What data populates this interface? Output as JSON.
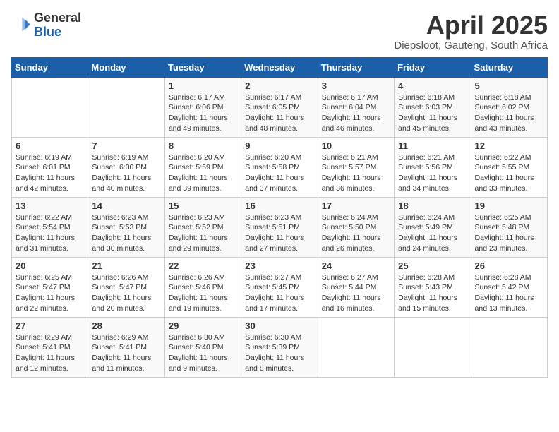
{
  "header": {
    "logo_general": "General",
    "logo_blue": "Blue",
    "title": "April 2025",
    "location": "Diepsloot, Gauteng, South Africa"
  },
  "weekdays": [
    "Sunday",
    "Monday",
    "Tuesday",
    "Wednesday",
    "Thursday",
    "Friday",
    "Saturday"
  ],
  "weeks": [
    [
      null,
      null,
      {
        "day": 1,
        "sunrise": "6:17 AM",
        "sunset": "6:06 PM",
        "daylight": "11 hours and 49 minutes."
      },
      {
        "day": 2,
        "sunrise": "6:17 AM",
        "sunset": "6:05 PM",
        "daylight": "11 hours and 48 minutes."
      },
      {
        "day": 3,
        "sunrise": "6:17 AM",
        "sunset": "6:04 PM",
        "daylight": "11 hours and 46 minutes."
      },
      {
        "day": 4,
        "sunrise": "6:18 AM",
        "sunset": "6:03 PM",
        "daylight": "11 hours and 45 minutes."
      },
      {
        "day": 5,
        "sunrise": "6:18 AM",
        "sunset": "6:02 PM",
        "daylight": "11 hours and 43 minutes."
      }
    ],
    [
      {
        "day": 6,
        "sunrise": "6:19 AM",
        "sunset": "6:01 PM",
        "daylight": "11 hours and 42 minutes."
      },
      {
        "day": 7,
        "sunrise": "6:19 AM",
        "sunset": "6:00 PM",
        "daylight": "11 hours and 40 minutes."
      },
      {
        "day": 8,
        "sunrise": "6:20 AM",
        "sunset": "5:59 PM",
        "daylight": "11 hours and 39 minutes."
      },
      {
        "day": 9,
        "sunrise": "6:20 AM",
        "sunset": "5:58 PM",
        "daylight": "11 hours and 37 minutes."
      },
      {
        "day": 10,
        "sunrise": "6:21 AM",
        "sunset": "5:57 PM",
        "daylight": "11 hours and 36 minutes."
      },
      {
        "day": 11,
        "sunrise": "6:21 AM",
        "sunset": "5:56 PM",
        "daylight": "11 hours and 34 minutes."
      },
      {
        "day": 12,
        "sunrise": "6:22 AM",
        "sunset": "5:55 PM",
        "daylight": "11 hours and 33 minutes."
      }
    ],
    [
      {
        "day": 13,
        "sunrise": "6:22 AM",
        "sunset": "5:54 PM",
        "daylight": "11 hours and 31 minutes."
      },
      {
        "day": 14,
        "sunrise": "6:23 AM",
        "sunset": "5:53 PM",
        "daylight": "11 hours and 30 minutes."
      },
      {
        "day": 15,
        "sunrise": "6:23 AM",
        "sunset": "5:52 PM",
        "daylight": "11 hours and 29 minutes."
      },
      {
        "day": 16,
        "sunrise": "6:23 AM",
        "sunset": "5:51 PM",
        "daylight": "11 hours and 27 minutes."
      },
      {
        "day": 17,
        "sunrise": "6:24 AM",
        "sunset": "5:50 PM",
        "daylight": "11 hours and 26 minutes."
      },
      {
        "day": 18,
        "sunrise": "6:24 AM",
        "sunset": "5:49 PM",
        "daylight": "11 hours and 24 minutes."
      },
      {
        "day": 19,
        "sunrise": "6:25 AM",
        "sunset": "5:48 PM",
        "daylight": "11 hours and 23 minutes."
      }
    ],
    [
      {
        "day": 20,
        "sunrise": "6:25 AM",
        "sunset": "5:47 PM",
        "daylight": "11 hours and 22 minutes."
      },
      {
        "day": 21,
        "sunrise": "6:26 AM",
        "sunset": "5:47 PM",
        "daylight": "11 hours and 20 minutes."
      },
      {
        "day": 22,
        "sunrise": "6:26 AM",
        "sunset": "5:46 PM",
        "daylight": "11 hours and 19 minutes."
      },
      {
        "day": 23,
        "sunrise": "6:27 AM",
        "sunset": "5:45 PM",
        "daylight": "11 hours and 17 minutes."
      },
      {
        "day": 24,
        "sunrise": "6:27 AM",
        "sunset": "5:44 PM",
        "daylight": "11 hours and 16 minutes."
      },
      {
        "day": 25,
        "sunrise": "6:28 AM",
        "sunset": "5:43 PM",
        "daylight": "11 hours and 15 minutes."
      },
      {
        "day": 26,
        "sunrise": "6:28 AM",
        "sunset": "5:42 PM",
        "daylight": "11 hours and 13 minutes."
      }
    ],
    [
      {
        "day": 27,
        "sunrise": "6:29 AM",
        "sunset": "5:41 PM",
        "daylight": "11 hours and 12 minutes."
      },
      {
        "day": 28,
        "sunrise": "6:29 AM",
        "sunset": "5:41 PM",
        "daylight": "11 hours and 11 minutes."
      },
      {
        "day": 29,
        "sunrise": "6:30 AM",
        "sunset": "5:40 PM",
        "daylight": "11 hours and 9 minutes."
      },
      {
        "day": 30,
        "sunrise": "6:30 AM",
        "sunset": "5:39 PM",
        "daylight": "11 hours and 8 minutes."
      },
      null,
      null,
      null
    ]
  ]
}
